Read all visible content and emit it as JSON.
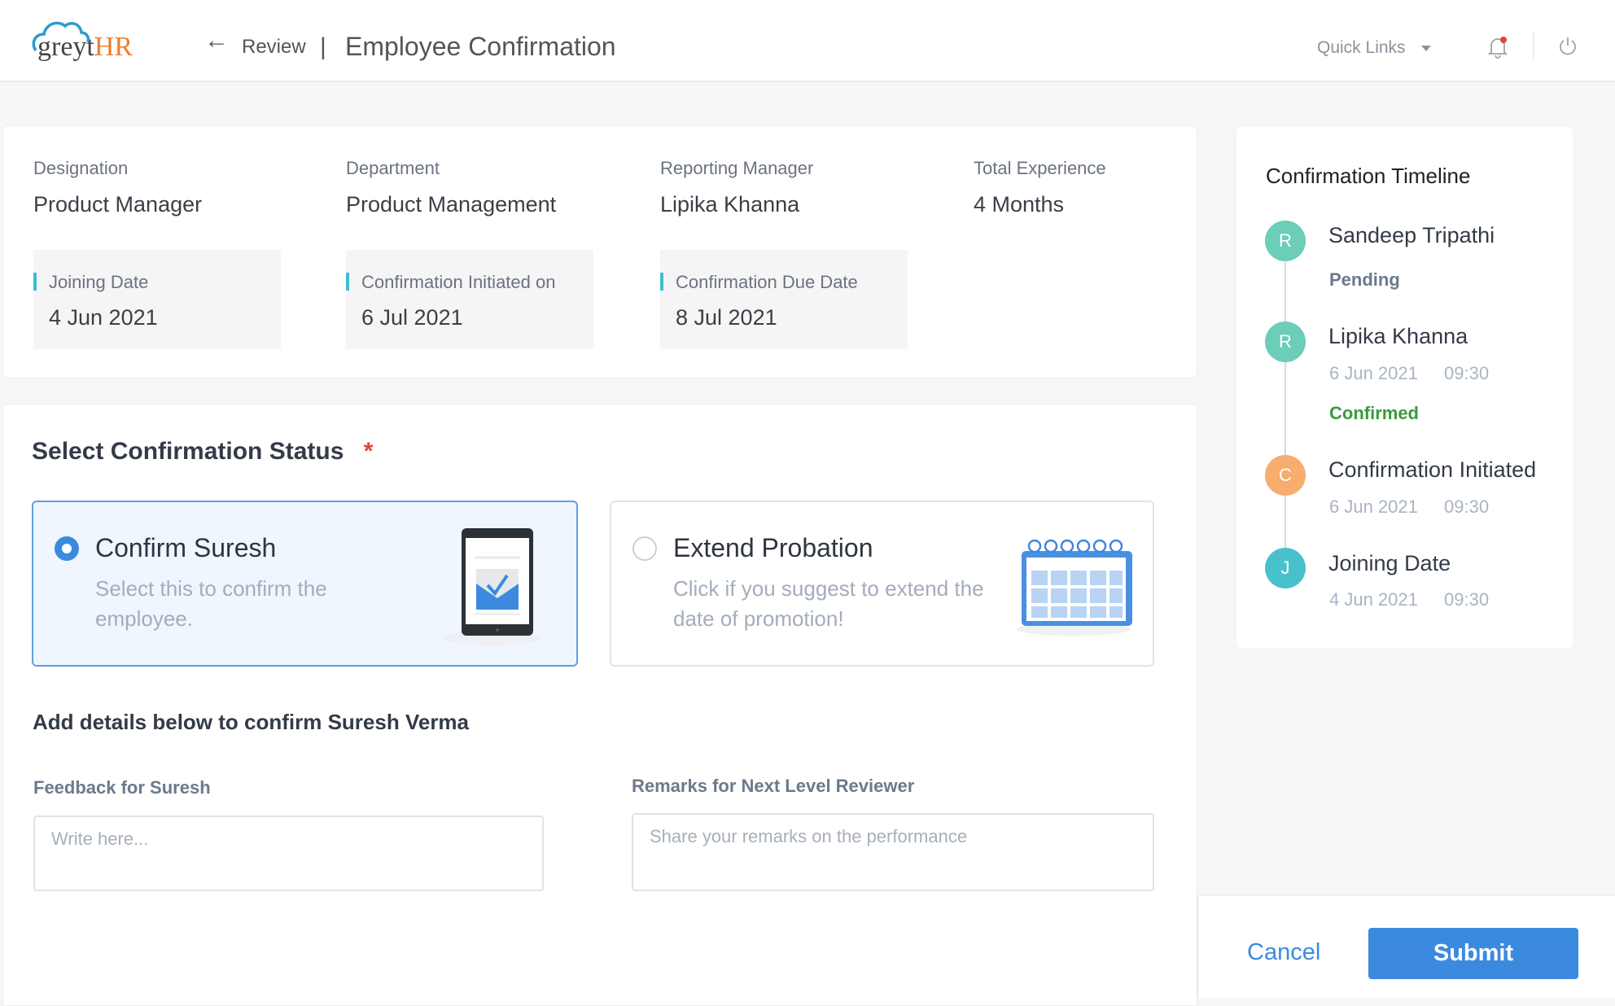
{
  "header": {
    "logo_text": "greytHR",
    "back_label": "Review",
    "separator": "|",
    "title": "Employee Confirmation",
    "quick_links": "Quick Links",
    "icons": [
      "arrow-left-icon",
      "chevron-down-icon",
      "bell-icon",
      "power-icon"
    ]
  },
  "info": {
    "fields": [
      {
        "label": "Designation",
        "value": "Product Manager"
      },
      {
        "label": "Department",
        "value": "Product Management"
      },
      {
        "label": "Reporting Manager",
        "value": "Lipika Khanna"
      },
      {
        "label": "Total Experience",
        "value": "4 Months"
      }
    ],
    "dates": [
      {
        "label": "Joining Date",
        "value": "4 Jun 2021"
      },
      {
        "label": "Confirmation Initiated on",
        "value": "6 Jul 2021"
      },
      {
        "label": "Confirmation Due Date",
        "value": "8 Jul 2021"
      }
    ]
  },
  "status": {
    "title": "Select Confirmation Status",
    "required": "*",
    "options": [
      {
        "title": "Confirm Suresh",
        "subtitle": "Select this to confirm the employee.",
        "selected": true
      },
      {
        "title": "Extend Probation",
        "subtitle": "Click if you suggest to extend the date of promotion!",
        "selected": false
      }
    ],
    "details_heading": "Add details below to confirm Suresh Verma",
    "feedback_label": "Feedback for Suresh",
    "feedback_placeholder": "Write here...",
    "remarks_label": "Remarks for Next Level Reviewer",
    "remarks_placeholder": "Share your remarks on the performance"
  },
  "timeline": {
    "title": "Confirmation Timeline",
    "items": [
      {
        "initial": "R",
        "name": "Sandeep Tripathi",
        "status": "Pending",
        "color": "#6ccdb8"
      },
      {
        "initial": "R",
        "name": "Lipika Khanna",
        "date": "6 Jun 2021",
        "time": "09:30",
        "status": "Confirmed",
        "color": "#6ccdb8"
      },
      {
        "initial": "C",
        "name": "Confirmation Initiated",
        "date": "6 Jun 2021",
        "time": "09:30",
        "color": "#f7ad6e"
      },
      {
        "initial": "J",
        "name": "Joining Date",
        "date": "4 Jun 2021",
        "time": "09:30",
        "color": "#49c1cc"
      }
    ]
  },
  "footer": {
    "cancel": "Cancel",
    "submit": "Submit"
  },
  "colors": {
    "accent": "#3b8ae0",
    "pending": "#6b7a8c",
    "confirmed": "#3a9a3e",
    "required": "#e0443a"
  }
}
